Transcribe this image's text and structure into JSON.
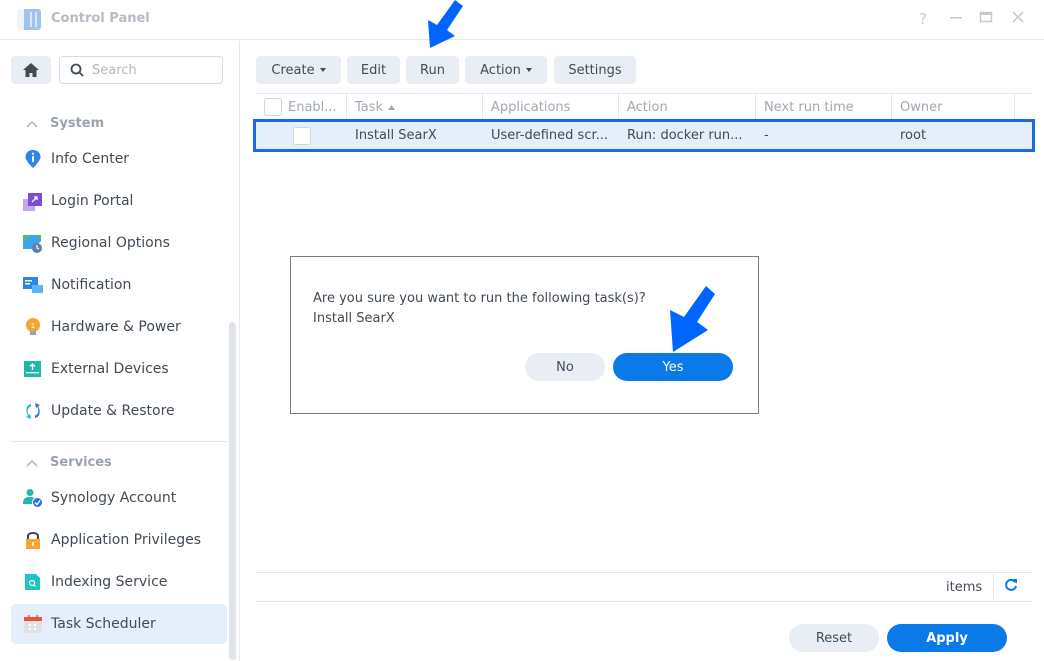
{
  "window": {
    "title": "Control Panel",
    "controls": [
      "help-icon",
      "minimize-icon",
      "maximize-icon",
      "close-icon"
    ]
  },
  "sidebar": {
    "search_placeholder": "Search",
    "groups": [
      {
        "label": "System",
        "items": [
          {
            "label": "Info Center",
            "icon": "info-center-icon"
          },
          {
            "label": "Login Portal",
            "icon": "login-portal-icon"
          },
          {
            "label": "Regional Options",
            "icon": "regional-options-icon"
          },
          {
            "label": "Notification",
            "icon": "notification-icon"
          },
          {
            "label": "Hardware & Power",
            "icon": "hardware-power-icon"
          },
          {
            "label": "External Devices",
            "icon": "external-devices-icon"
          },
          {
            "label": "Update & Restore",
            "icon": "update-restore-icon"
          }
        ]
      },
      {
        "label": "Services",
        "items": [
          {
            "label": "Synology Account",
            "icon": "synology-account-icon"
          },
          {
            "label": "Application Privileges",
            "icon": "application-privileges-icon"
          },
          {
            "label": "Indexing Service",
            "icon": "indexing-service-icon"
          },
          {
            "label": "Task Scheduler",
            "icon": "task-scheduler-icon",
            "active": true
          }
        ]
      }
    ]
  },
  "toolbar": {
    "create": "Create",
    "edit": "Edit",
    "run": "Run",
    "action": "Action",
    "settings": "Settings"
  },
  "table": {
    "columns": [
      "Enabl...",
      "Task",
      "Applications",
      "Action",
      "Next run time",
      "Owner"
    ],
    "sort_column": "Task",
    "sort_dir": "asc",
    "rows": [
      {
        "enabled": false,
        "task": "Install SearX",
        "applications": "User-defined scr...",
        "action": "Run: docker run...",
        "next_run_time": "-",
        "owner": "root",
        "selected": true
      }
    ]
  },
  "footer": {
    "items_label": "items",
    "reset": "Reset",
    "apply": "Apply"
  },
  "dialog": {
    "message": "Are you sure you want to run the following task(s)?",
    "task_name": "Install SearX",
    "no": "No",
    "yes": "Yes"
  },
  "colors": {
    "accent": "#0a7ae8",
    "selection_border": "#1a6ae8",
    "selection_bg": "#e4effb",
    "annotation_arrow": "#0064ff"
  }
}
